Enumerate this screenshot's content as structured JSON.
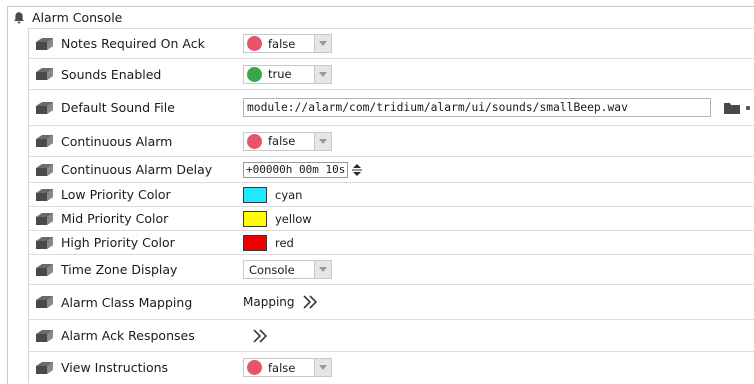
{
  "panel": {
    "title": "Alarm Console",
    "icon": "bell-icon"
  },
  "properties": [
    {
      "label": "Notes Required On Ack",
      "type": "boolean",
      "value": "false",
      "status_color": "#e8546a"
    },
    {
      "label": "Sounds Enabled",
      "type": "boolean",
      "value": "true",
      "status_color": "#3aa84a"
    },
    {
      "label": "Default Sound File",
      "type": "file",
      "value": "module://alarm/com/tridium/alarm/ui/sounds/smallBeep.wav",
      "action_icon": "folder-icon"
    },
    {
      "label": "Continuous Alarm",
      "type": "boolean",
      "value": "false",
      "status_color": "#e8546a"
    },
    {
      "label": "Continuous Alarm Delay",
      "type": "reltime",
      "value": "+00000h 00m 10s"
    },
    {
      "label": "Low Priority Color",
      "type": "color",
      "value": "cyan",
      "swatch": "#22e8ff"
    },
    {
      "label": "Mid Priority Color",
      "type": "color",
      "value": "yellow",
      "swatch": "#ffff00"
    },
    {
      "label": "High Priority Color",
      "type": "color",
      "value": "red",
      "swatch": "#ee0000"
    },
    {
      "label": "Time Zone Display",
      "type": "enum",
      "value": "Console"
    },
    {
      "label": "Alarm Class Mapping",
      "type": "link",
      "value": "Mapping"
    },
    {
      "label": "Alarm Ack Responses",
      "type": "link",
      "value": ""
    },
    {
      "label": "View Instructions",
      "type": "boolean",
      "value": "false",
      "status_color": "#e8546a"
    }
  ]
}
